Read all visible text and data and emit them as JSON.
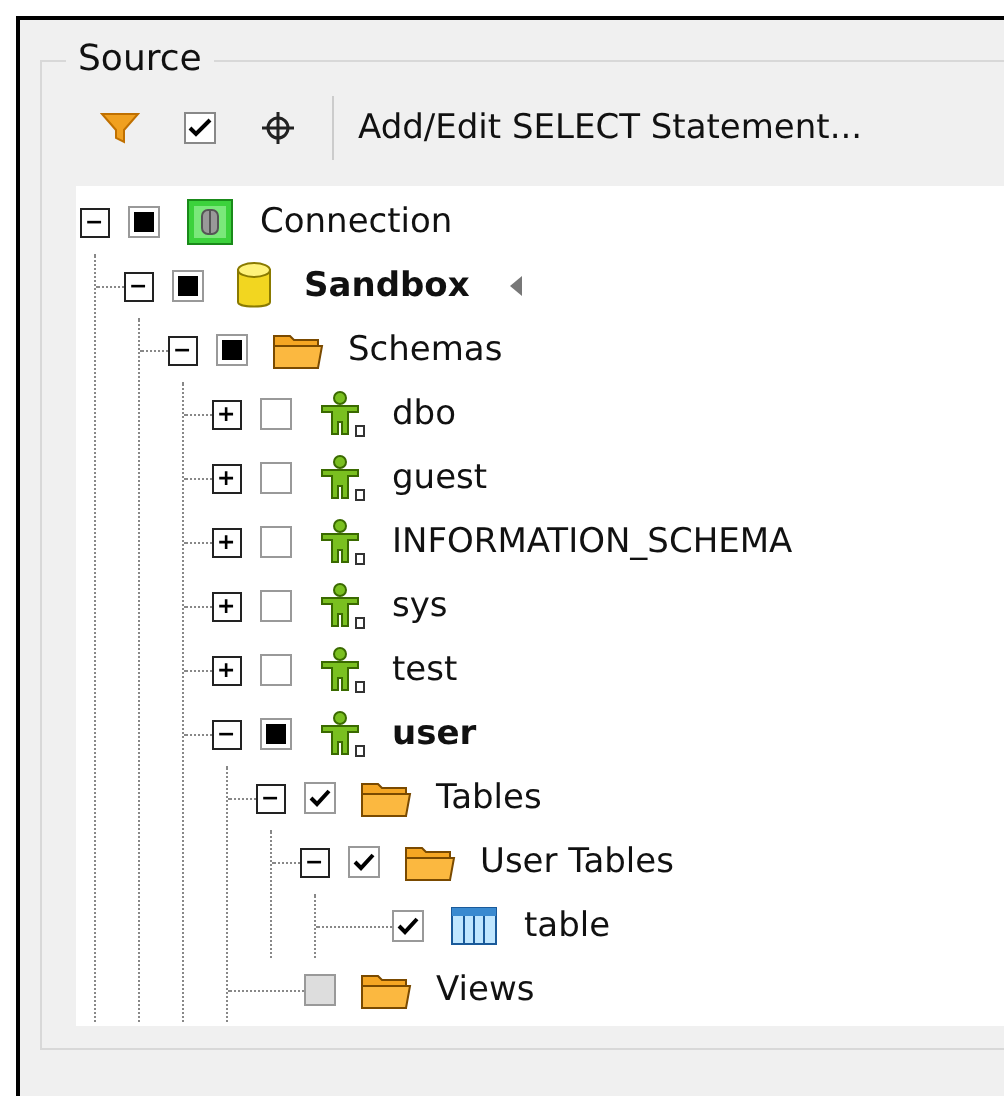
{
  "group": {
    "title": "Source"
  },
  "toolbar": {
    "icons": [
      {
        "kind": "filter"
      },
      {
        "kind": "check"
      },
      {
        "kind": "locate"
      }
    ],
    "select_button": "Add/Edit SELECT Statement..."
  },
  "tree": [
    {
      "label": "Connection",
      "kind": "connection",
      "checked": false,
      "mixed": true,
      "disabled": false,
      "expanded": true,
      "bold": false,
      "marker": false,
      "children": [
        {
          "label": "Sandbox",
          "kind": "database",
          "checked": false,
          "mixed": true,
          "disabled": false,
          "expanded": true,
          "bold": true,
          "marker": true,
          "children": [
            {
              "label": "Schemas",
              "kind": "folder",
              "checked": false,
              "mixed": true,
              "disabled": false,
              "expanded": true,
              "bold": false,
              "marker": false,
              "children": [
                {
                  "label": "dbo",
                  "kind": "schema",
                  "checked": false,
                  "mixed": false,
                  "disabled": false,
                  "expanded": false,
                  "bold": false,
                  "marker": false
                },
                {
                  "label": "guest",
                  "kind": "schema",
                  "checked": false,
                  "mixed": false,
                  "disabled": false,
                  "expanded": false,
                  "bold": false,
                  "marker": false
                },
                {
                  "label": "INFORMATION_SCHEMA",
                  "kind": "schema",
                  "checked": false,
                  "mixed": false,
                  "disabled": false,
                  "expanded": false,
                  "bold": false,
                  "marker": false
                },
                {
                  "label": "sys",
                  "kind": "schema",
                  "checked": false,
                  "mixed": false,
                  "disabled": false,
                  "expanded": false,
                  "bold": false,
                  "marker": false
                },
                {
                  "label": "test",
                  "kind": "schema",
                  "checked": false,
                  "mixed": false,
                  "disabled": false,
                  "expanded": false,
                  "bold": false,
                  "marker": false
                },
                {
                  "label": "user",
                  "kind": "schema",
                  "checked": false,
                  "mixed": true,
                  "disabled": false,
                  "expanded": true,
                  "bold": true,
                  "marker": false,
                  "children": [
                    {
                      "label": "Tables",
                      "kind": "folder",
                      "checked": true,
                      "mixed": false,
                      "disabled": false,
                      "expanded": true,
                      "bold": false,
                      "marker": false,
                      "children": [
                        {
                          "label": "User Tables",
                          "kind": "folder",
                          "checked": true,
                          "mixed": false,
                          "disabled": false,
                          "expanded": true,
                          "bold": false,
                          "marker": false,
                          "children": [
                            {
                              "label": "table",
                              "kind": "table",
                              "checked": true,
                              "mixed": false,
                              "disabled": false,
                              "bold": false,
                              "marker": false
                            }
                          ]
                        }
                      ]
                    },
                    {
                      "label": "Views",
                      "kind": "folder",
                      "checked": false,
                      "mixed": false,
                      "disabled": true,
                      "bold": false,
                      "marker": false
                    }
                  ]
                }
              ]
            }
          ]
        }
      ]
    }
  ]
}
